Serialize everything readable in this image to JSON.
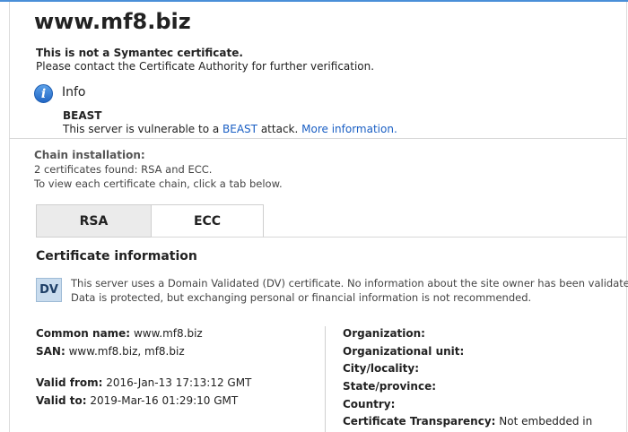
{
  "site": {
    "title": "www.mf8.biz"
  },
  "warning": {
    "line1": "This is not a Symantec certificate.",
    "line2": "Please contact the Certificate Authority for further verification."
  },
  "info": {
    "title": "Info",
    "beast_title": "BEAST",
    "beast_text_prefix": "This server is vulnerable to a ",
    "beast_link": "BEAST",
    "beast_text_suffix": " attack. ",
    "more_link": "More information."
  },
  "chain": {
    "title": "Chain installation:",
    "line1": "2 certificates found: RSA and ECC.",
    "line2": "To view each certificate chain, click a tab below."
  },
  "tabs": [
    {
      "label": "RSA",
      "active": true
    },
    {
      "label": "ECC",
      "active": false
    }
  ],
  "certificate": {
    "title": "Certificate information",
    "badge": "DV",
    "dv_line1": "This server uses a Domain Validated (DV) certificate. No information about the site owner has been validated.",
    "dv_line2": "Data is protected, but exchanging personal or financial information is not recommended.",
    "left": {
      "common_name_label": "Common name:",
      "common_name": "www.mf8.biz",
      "san_label": "SAN:",
      "san": "www.mf8.biz, mf8.biz",
      "valid_from_label": "Valid from:",
      "valid_from": "2016-Jan-13 17:13:12 GMT",
      "valid_to_label": "Valid to:",
      "valid_to": "2019-Mar-16 01:29:10 GMT"
    },
    "right": {
      "organization_label": "Organization:",
      "org_unit_label": "Organizational unit:",
      "city_label": "City/locality:",
      "state_label": "State/province:",
      "country_label": "Country:",
      "ct_label": "Certificate Transparency:",
      "ct_value": "Not embedded in"
    }
  },
  "colors": {
    "accent": "#4a8fd8",
    "link": "#1a5fc4",
    "badge_bg": "#c9dcee"
  },
  "icons": {
    "info": "info-icon"
  }
}
